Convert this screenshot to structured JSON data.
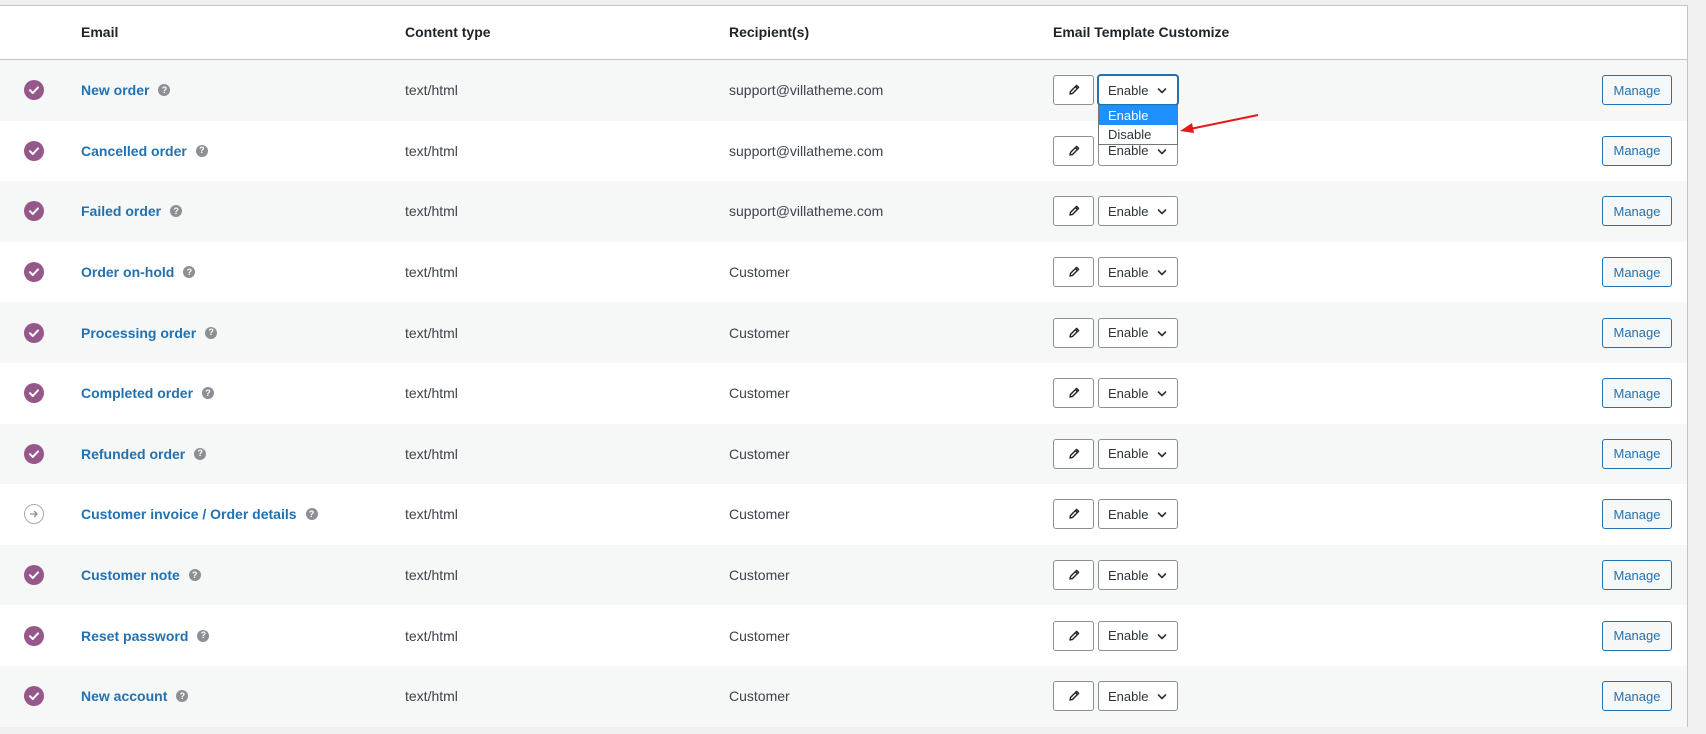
{
  "columns": {
    "email": "Email",
    "content_type": "Content type",
    "recipients": "Recipient(s)",
    "template_customize": "Email Template Customize"
  },
  "rows": [
    {
      "name": "New order",
      "enabled": true,
      "content_type": "text/html",
      "recipient": "support@villatheme.com",
      "select_value": "Enable",
      "manage": "Manage"
    },
    {
      "name": "Cancelled order",
      "enabled": true,
      "content_type": "text/html",
      "recipient": "support@villatheme.com",
      "select_value": "Enable",
      "manage": "Manage"
    },
    {
      "name": "Failed order",
      "enabled": true,
      "content_type": "text/html",
      "recipient": "support@villatheme.com",
      "select_value": "Enable",
      "manage": "Manage"
    },
    {
      "name": "Order on-hold",
      "enabled": true,
      "content_type": "text/html",
      "recipient": "Customer",
      "select_value": "Enable",
      "manage": "Manage"
    },
    {
      "name": "Processing order",
      "enabled": true,
      "content_type": "text/html",
      "recipient": "Customer",
      "select_value": "Enable",
      "manage": "Manage"
    },
    {
      "name": "Completed order",
      "enabled": true,
      "content_type": "text/html",
      "recipient": "Customer",
      "select_value": "Enable",
      "manage": "Manage"
    },
    {
      "name": "Refunded order",
      "enabled": true,
      "content_type": "text/html",
      "recipient": "Customer",
      "select_value": "Enable",
      "manage": "Manage"
    },
    {
      "name": "Customer invoice / Order details",
      "enabled": false,
      "content_type": "text/html",
      "recipient": "Customer",
      "select_value": "Enable",
      "manage": "Manage"
    },
    {
      "name": "Customer note",
      "enabled": true,
      "content_type": "text/html",
      "recipient": "Customer",
      "select_value": "Enable",
      "manage": "Manage"
    },
    {
      "name": "Reset password",
      "enabled": true,
      "content_type": "text/html",
      "recipient": "Customer",
      "select_value": "Enable",
      "manage": "Manage"
    },
    {
      "name": "New account",
      "enabled": true,
      "content_type": "text/html",
      "recipient": "Customer",
      "select_value": "Enable",
      "manage": "Manage"
    }
  ],
  "dropdown": {
    "options": [
      "Enable",
      "Disable"
    ],
    "selected": "Enable"
  },
  "help_glyph": "?",
  "icons": {
    "enabled": "check-circle-icon",
    "manual": "arrow-right-circle-icon",
    "edit": "pencil-icon",
    "select": "chevron-down-icon",
    "annotation": "red-arrow-icon"
  },
  "colors": {
    "enabled_status": "#96588a",
    "link": "#2271b1",
    "annotation": "#e3191b",
    "dropdown_highlight": "#1e90ff"
  }
}
